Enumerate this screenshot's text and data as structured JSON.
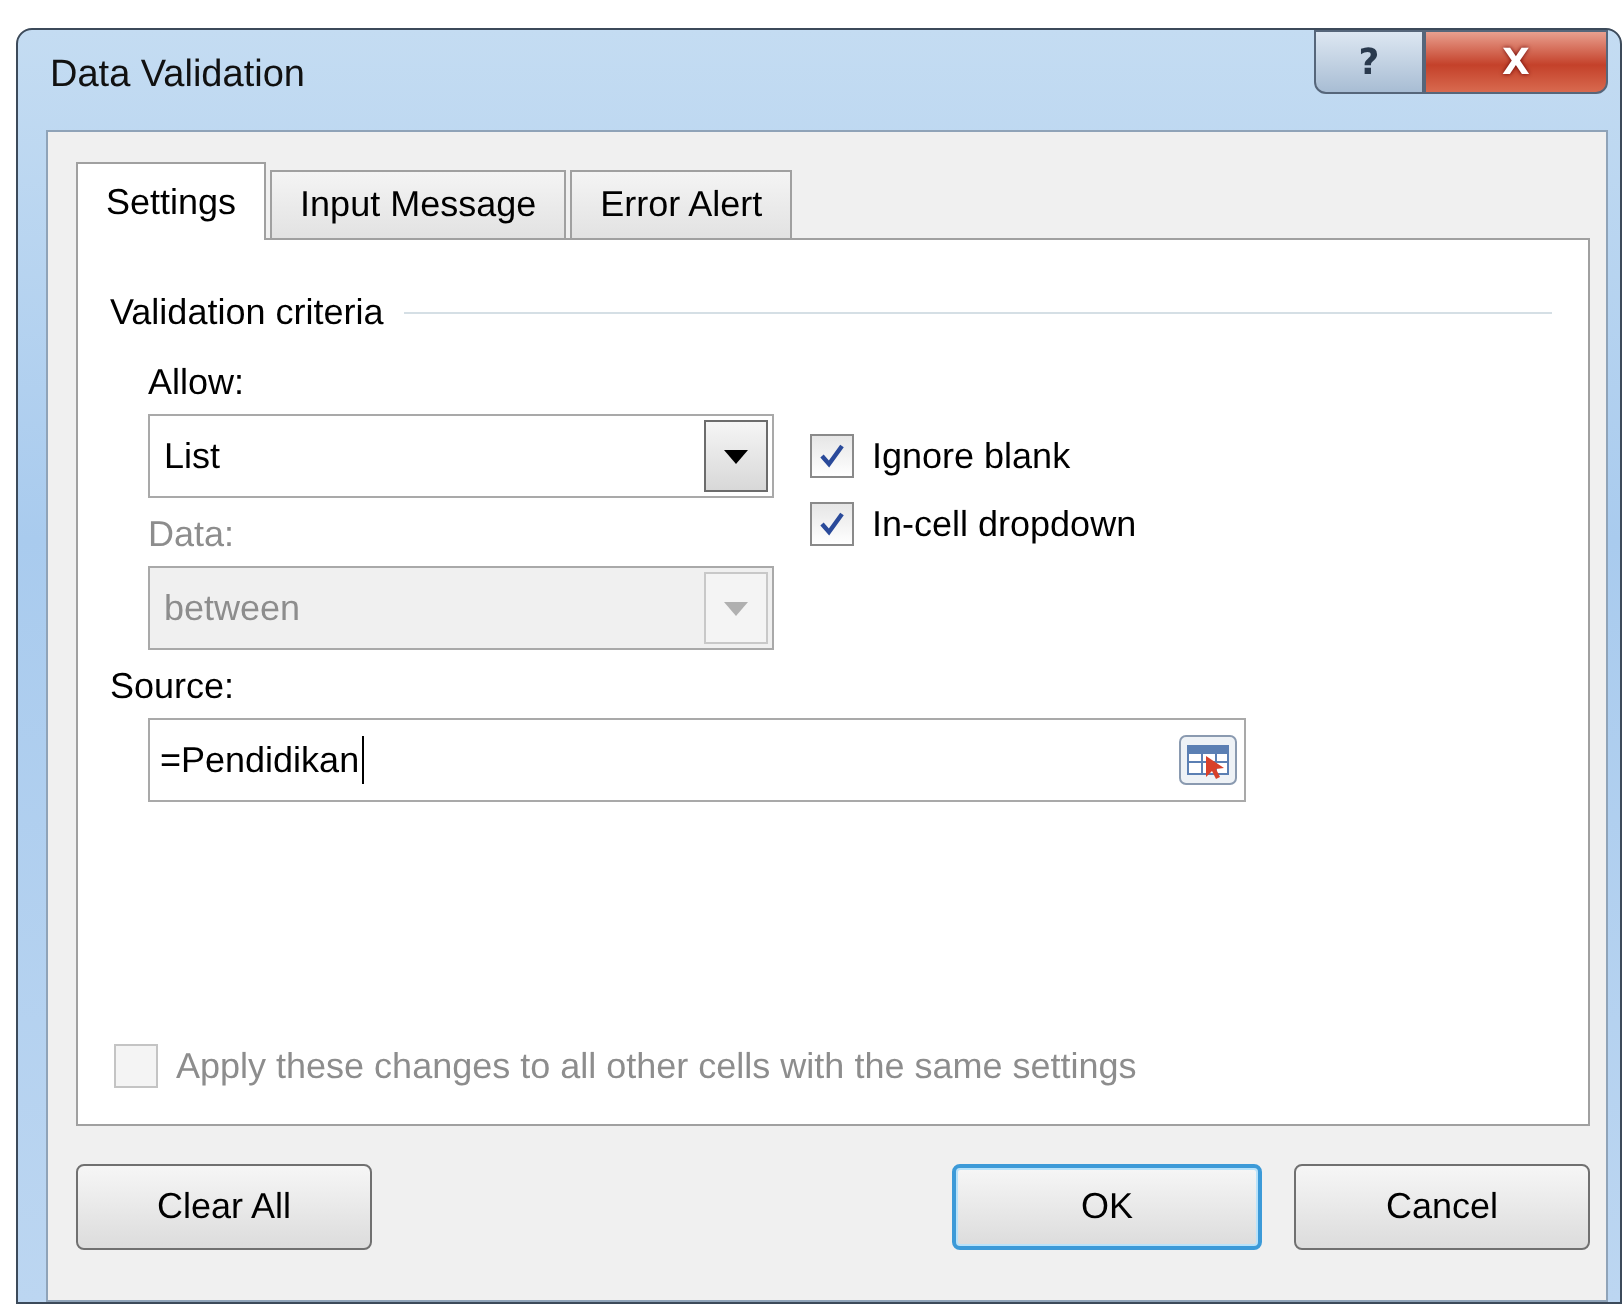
{
  "window": {
    "title": "Data Validation",
    "help_button": "?",
    "close_button": "X"
  },
  "tabs": [
    {
      "label": "Settings",
      "selected": true
    },
    {
      "label": "Input Message",
      "selected": false
    },
    {
      "label": "Error Alert",
      "selected": false
    }
  ],
  "group": {
    "title": "Validation criteria"
  },
  "allow": {
    "label": "Allow:",
    "value": "List",
    "disabled": false
  },
  "checkboxes": [
    {
      "label": "Ignore blank",
      "checked": true
    },
    {
      "label": "In-cell dropdown",
      "checked": true
    }
  ],
  "data": {
    "label": "Data:",
    "value": "between",
    "disabled": true
  },
  "source": {
    "label": "Source:",
    "value": "=Pendidikan"
  },
  "apply_all": {
    "label": "Apply these changes to all other cells with the same settings",
    "checked": false,
    "disabled": true
  },
  "buttons": [
    {
      "label": "Clear All",
      "default": false
    },
    {
      "label": "OK",
      "default": true
    },
    {
      "label": "Cancel",
      "default": false
    }
  ]
}
